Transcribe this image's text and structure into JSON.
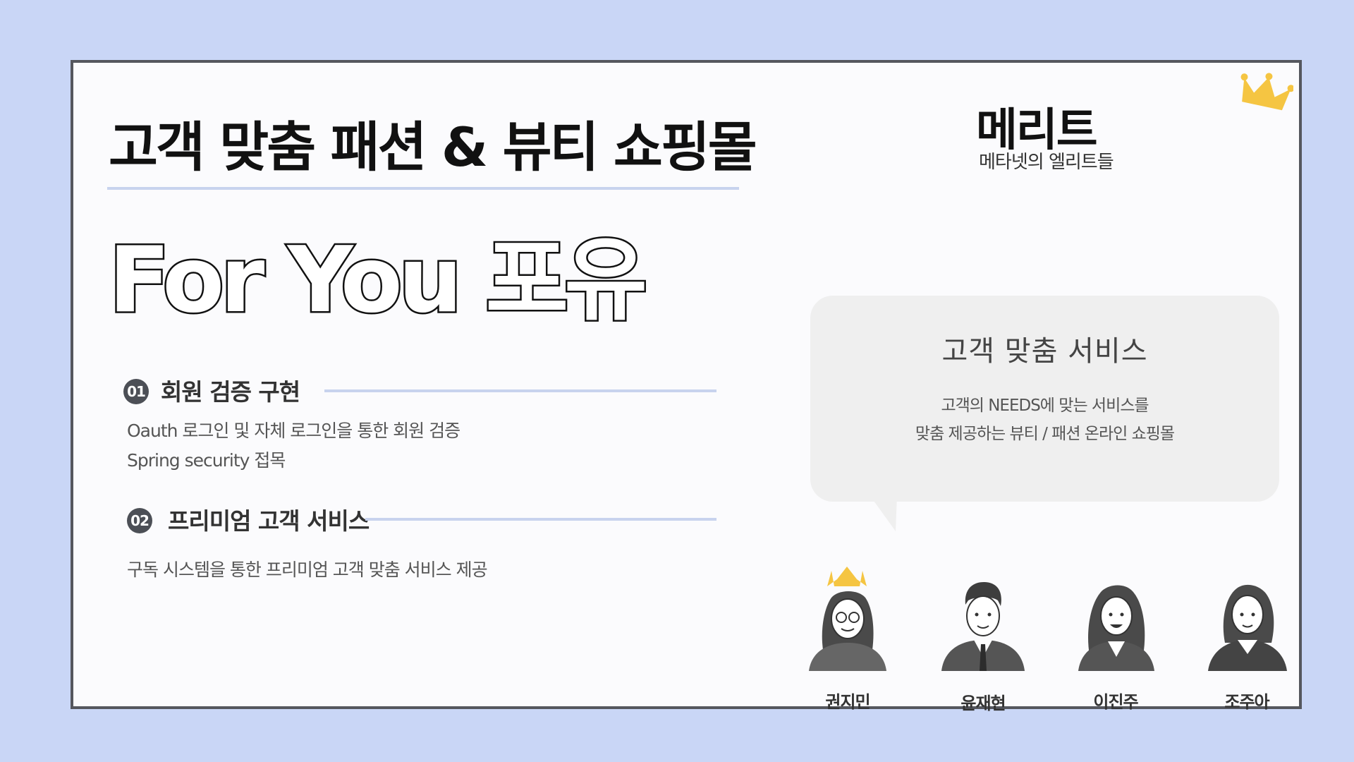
{
  "title": "고객 맞춤 패션 & 뷰티 쇼핑몰",
  "hero": {
    "text": "For You 포유"
  },
  "brand": {
    "name": "메리트",
    "tagline": "메타넷의 엘리트들"
  },
  "sections": [
    {
      "number": "01",
      "heading": "회원 검증 구현",
      "lines": [
        "Oauth 로그인 및 자체 로그인을 통한 회원 검증",
        "Spring security 접목"
      ]
    },
    {
      "number": "02",
      "heading": "프리미엄 고객 서비스",
      "lines": [
        "구독 시스템을 통한 프리미엄 고객 맞춤 서비스 제공"
      ]
    }
  ],
  "bubble": {
    "title": "고객 맞춤 서비스",
    "lines": [
      "고객의 NEEDS에 맞는 서비스를",
      "맞춤 제공하는 뷰티 / 패션 온라인 쇼핑몰"
    ]
  },
  "members": [
    {
      "name": "권지민"
    },
    {
      "name": "윤재현"
    },
    {
      "name": "이진주"
    },
    {
      "name": "조주아"
    }
  ],
  "colors": {
    "background": "#c9d6f6",
    "accent_line": "#c8d3ee",
    "crown": "#f5c542",
    "card_border": "#55575e"
  }
}
